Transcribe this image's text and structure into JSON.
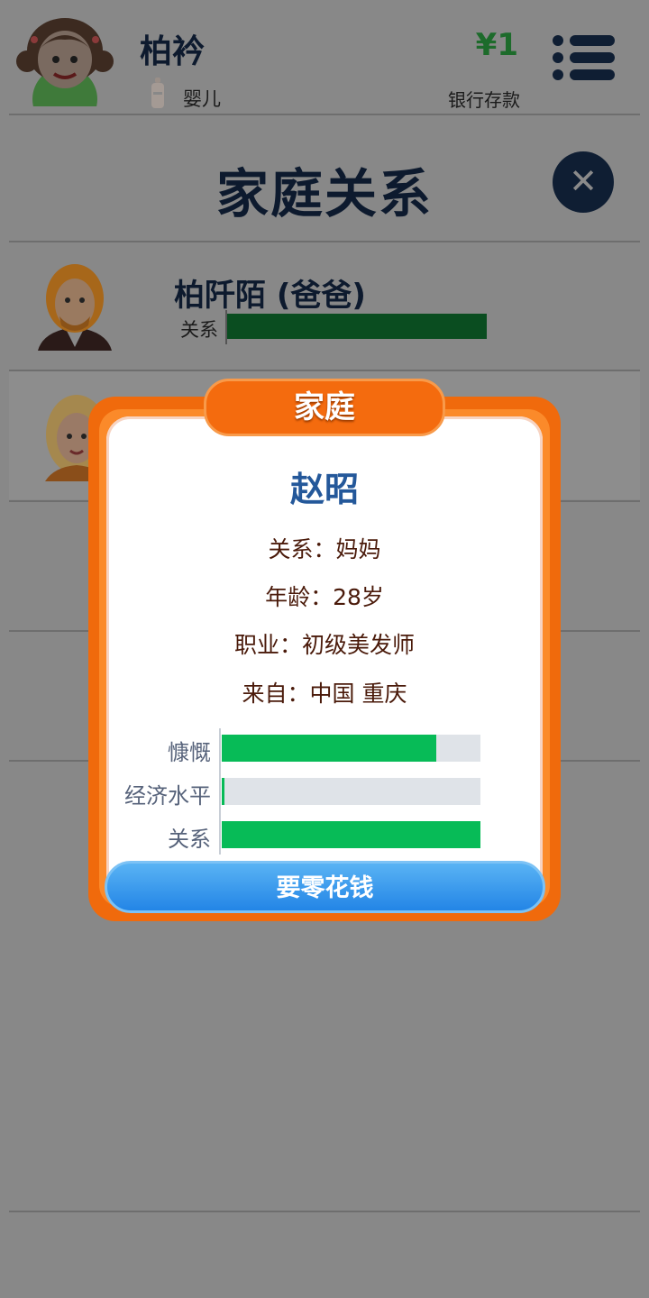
{
  "header": {
    "player_name": "柏衿",
    "life_stage": "婴儿",
    "money": "¥1",
    "bank_label": "银行存款"
  },
  "page": {
    "title": "家庭关系"
  },
  "family": [
    {
      "name": "柏阡陌 (爸爸)",
      "relation_label": "关系",
      "relation_level": 1.0
    },
    {
      "name": "",
      "relation_label": "",
      "relation_level": null
    }
  ],
  "dialog": {
    "tab_title": "家庭",
    "name": "赵昭",
    "relation": "关系：妈妈",
    "age": "年龄：28岁",
    "job": "职业：初级美发师",
    "origin": "来自：中国 重庆",
    "stats": [
      {
        "label": "慷慨",
        "value": 0.83
      },
      {
        "label": "经济水平",
        "value": 0.01
      },
      {
        "label": "关系",
        "value": 1.0
      }
    ],
    "action_label": "要零花钱"
  },
  "colors": {
    "dialog_orange": "#f06a0c",
    "stat_green": "#07bb57",
    "button_blue": "#2385e6",
    "overlay": "#888888"
  }
}
